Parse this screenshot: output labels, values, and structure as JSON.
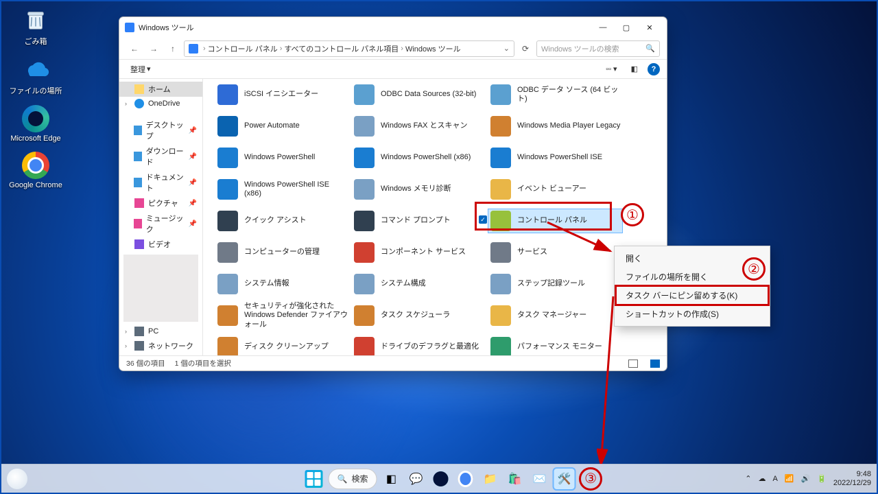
{
  "desktop_icons": [
    {
      "label": "ごみ箱"
    },
    {
      "label": "ファイルの場所"
    },
    {
      "label": "Microsoft Edge"
    },
    {
      "label": "Google Chrome"
    }
  ],
  "window": {
    "title": "Windows ツール",
    "breadcrumbs": [
      "コントロール パネル",
      "すべてのコントロール パネル項目",
      "Windows ツール"
    ],
    "search_placeholder": "Windows ツールの検索",
    "organize": "整理",
    "sidebar": {
      "home": "ホーム",
      "onedrive": "OneDrive",
      "quick": [
        {
          "label": "デスクトップ"
        },
        {
          "label": "ダウンロード"
        },
        {
          "label": "ドキュメント"
        },
        {
          "label": "ピクチャ"
        },
        {
          "label": "ミュージック"
        },
        {
          "label": "ビデオ"
        }
      ],
      "pc": "PC",
      "network": "ネットワーク"
    },
    "items": [
      "iSCSI イニシエーター",
      "ODBC Data Sources (32-bit)",
      "ODBC データ ソース (64 ビット)",
      "Power Automate",
      "Windows FAX とスキャン",
      "Windows Media Player Legacy",
      "Windows PowerShell",
      "Windows PowerShell (x86)",
      "Windows PowerShell ISE",
      "Windows PowerShell ISE (x86)",
      "Windows メモリ診断",
      "イベント ビューアー",
      "クイック アシスト",
      "コマンド プロンプト",
      "コントロール パネル",
      "コンピューターの管理",
      "コンポーネント サービス",
      "サービス",
      "システム情報",
      "システム構成",
      "ステップ記録ツール",
      "セキュリティが強化された Windows Defender ファイアウォール",
      "タスク スケジューラ",
      "タスク マネージャー",
      "ディスク クリーンアップ",
      "ドライブのデフラグと最適化",
      "パフォーマンス モニター"
    ],
    "status_count": "36 個の項目",
    "status_sel": "1 個の項目を選択"
  },
  "context_menu": [
    "開く",
    "ファイルの場所を開く",
    "タスク バーにピン留めする(K)",
    "ショートカットの作成(S)"
  ],
  "annotations": {
    "1": "①",
    "2": "②",
    "3": "③"
  },
  "taskbar": {
    "search": "検索",
    "ime": "A",
    "time": "9:48",
    "date": "2022/12/29"
  }
}
